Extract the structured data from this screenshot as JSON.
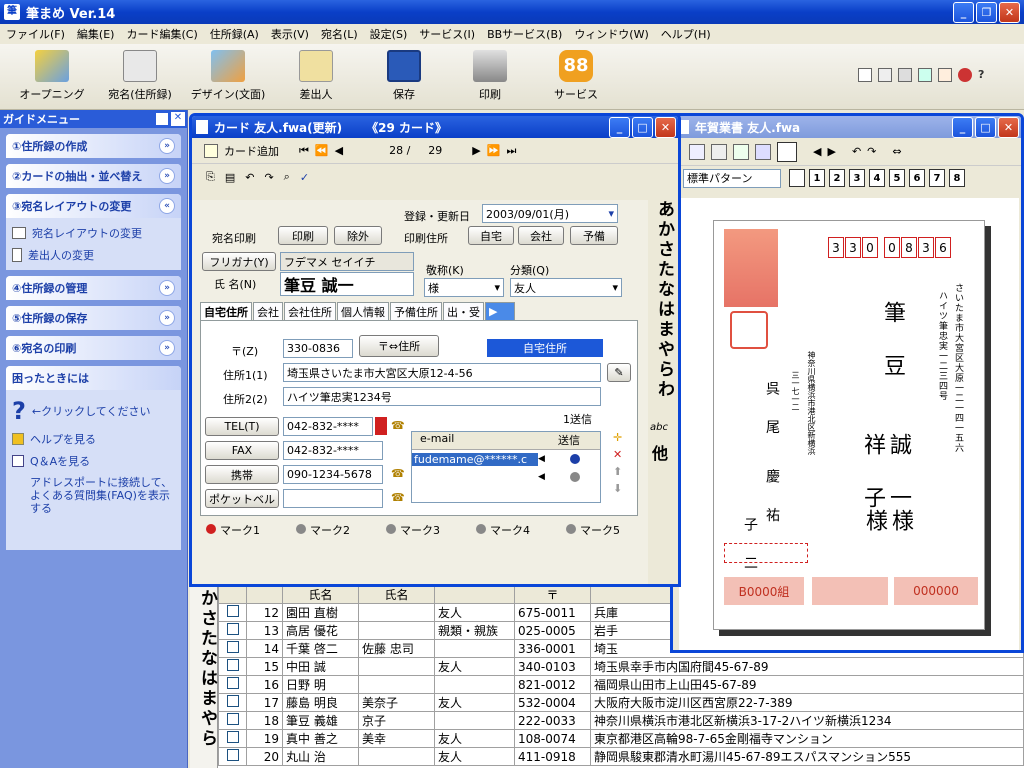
{
  "app": {
    "title": "筆まめ Ver.14"
  },
  "menu": [
    "ファイル(F)",
    "編集(E)",
    "カード編集(C)",
    "住所録(A)",
    "表示(V)",
    "宛名(L)",
    "設定(S)",
    "サービス(I)",
    "BBサービス(B)",
    "ウィンドウ(W)",
    "ヘルプ(H)"
  ],
  "toolbar": {
    "opening": "オープニング",
    "atena": "宛名(住所録)",
    "design": "デザイン(文面)",
    "sender": "差出人",
    "save": "保存",
    "print": "印刷",
    "service": "サービス"
  },
  "guide": {
    "title": "ガイドメニュー",
    "g1": "①住所録の作成",
    "g2": "②カードの抽出・並べ替え",
    "g3": "③宛名レイアウトの変更",
    "g3a": "宛名レイアウトの変更",
    "g3b": "差出人の変更",
    "g4": "④住所録の管理",
    "g5": "⑤住所録の保存",
    "g6": "⑥宛名の印刷",
    "help_title": "困ったときには",
    "click_hint": "←クリックしてください",
    "help_see": "ヘルプを見る",
    "qa": "Q＆Aを見る",
    "faq": "アドレスポートに接続して、よくある質問集(FAQ)を表示する"
  },
  "card": {
    "title": "カード 友人.fwa(更新)",
    "count": "《29 カード》",
    "add": "カード追加",
    "page_cur": "28 /",
    "page_total": "29",
    "reg_label": "登録・更新日",
    "reg_date": "2003/09/01(月)",
    "atena_print": "宛名印刷",
    "print_btn": "印刷",
    "exclude_btn": "除外",
    "print_addr": "印刷住所",
    "addr_home": "自宅",
    "addr_company": "会社",
    "addr_spare": "予備",
    "furigana_btn": "フリガナ(Y)",
    "furigana": "フデマメ セイイチ",
    "name_label": "氏 名(N)",
    "name": "筆豆 誠一",
    "keisho_label": "敬称(K)",
    "keisho": "様",
    "bunrui_label": "分類(Q)",
    "bunrui": "友人",
    "tabs": [
      "自宅住所",
      "会社",
      "会社住所",
      "個人情報",
      "予備住所",
      "出・受"
    ],
    "zip_label": "〒(Z)",
    "zip": "330-0836",
    "zip_btn": "〒⇔住所",
    "addr_type": "自宅住所",
    "addr1_label": "住所1(1)",
    "addr1": "埼玉県さいたま市大宮区大原12-4-56",
    "addr2_label": "住所2(2)",
    "addr2": "ハイツ筆忠実1234号",
    "send1": "1送信",
    "tel_label": "TEL(T)",
    "tel": "042-832-****",
    "fax_label": "FAX",
    "fax": "042-832-****",
    "mobile_label": "携帯",
    "mobile": "090-1234-5678",
    "pager_label": "ポケットベル",
    "pager": "",
    "email_h": "e-mail",
    "send_h": "送信",
    "email": "fudemame@******.c",
    "marks": [
      "マーク1",
      "マーク2",
      "マーク3",
      "マーク4",
      "マーク5"
    ],
    "index_chars": "あかさたなはまやらわ",
    "index_abc": "abc",
    "index_other": "他"
  },
  "nenga": {
    "title": "年賀業書 友人.fwa",
    "pattern": "標準パターン",
    "nums": [
      "1",
      "2",
      "3",
      "4",
      "5",
      "6",
      "7",
      "8"
    ],
    "zip": [
      "3",
      "3",
      "0",
      "0",
      "8",
      "3",
      "6"
    ],
    "addr_line1": "さいたま市大宮区大原一二一四一五六",
    "addr_line2": "ハイツ筆忠実一二三四号",
    "name1": "筆 豆",
    "name2": "誠 一",
    "name3": "祥 子",
    "sama1": "様",
    "sama2": "様",
    "sender_addr1": "神奈川県横浜市港北区新横浜",
    "sender_addr2": "三一七一二",
    "sender_name1": "呉 尾",
    "sender_name2": "慶 祐",
    "sender_name3": "子 二",
    "bottom1": "B0000組",
    "bottom3": "000000"
  },
  "list": {
    "headers": [
      "",
      "",
      "",
      "氏名",
      "氏名",
      "",
      "〒",
      ""
    ],
    "index_chars": "かさたなはまやら",
    "rows": [
      [
        "12",
        "園田 直樹",
        "",
        "友人",
        "675-0011",
        "兵庫"
      ],
      [
        "13",
        "高居 優花",
        "",
        "親類・親族",
        "025-0005",
        "岩手"
      ],
      [
        "14",
        "千葉 啓二",
        "佐藤 忠司",
        "",
        "336-0001",
        "埼玉"
      ],
      [
        "15",
        "中田 誠",
        "",
        "友人",
        "340-0103",
        "埼玉県幸手市内国府間45-67-89"
      ],
      [
        "16",
        "日野 明",
        "",
        "",
        "821-0012",
        "福岡県山田市上山田45-67-89"
      ],
      [
        "17",
        "藤島 明良",
        "美奈子",
        "友人",
        "532-0004",
        "大阪府大阪市淀川区西宮原22-7-389"
      ],
      [
        "18",
        "筆豆 義雄",
        "京子",
        "",
        "222-0033",
        "神奈川県横浜市港北区新横浜3-17-2ハイツ新横浜1234"
      ],
      [
        "19",
        "真中 善之",
        "美幸",
        "友人",
        "108-0074",
        "東京都港区高輪98-7-65金剛福寺マンション"
      ],
      [
        "20",
        "丸山 治",
        "",
        "友人",
        "411-0918",
        "静岡県駿東郡清水町湯川45-67-89エスパスマンション555"
      ]
    ]
  },
  "colors": {
    "xp_blue": "#0a46d8",
    "accent_red": "#d02020"
  }
}
